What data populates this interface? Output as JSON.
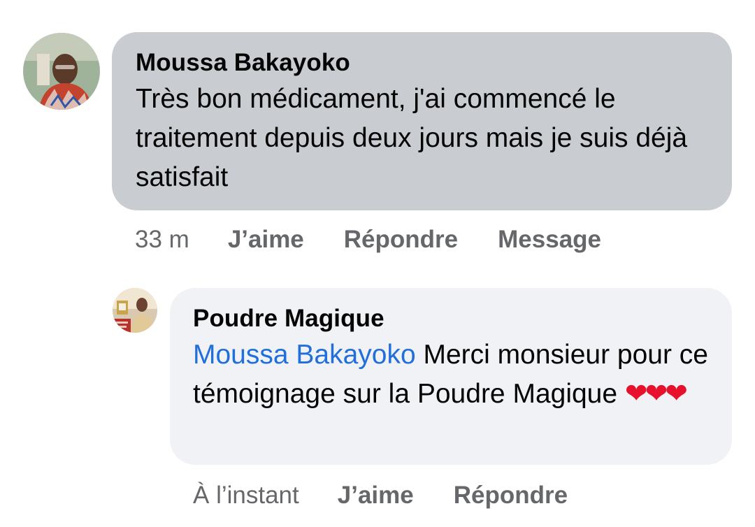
{
  "comment": {
    "author": "Moussa Bakayoko",
    "text": "Très bon médicament, j'ai commencé le traitement depuis deux jours mais je suis déjà satisfait",
    "time": "33 m",
    "actions": {
      "like": "J’aime",
      "reply": "Répondre",
      "message": "Message"
    }
  },
  "reply": {
    "author": "Poudre Magique",
    "mention": "Moussa Bakayoko",
    "text": " Merci monsieur pour ce témoignage sur la Poudre Magique ",
    "hearts": "❤❤❤",
    "time": "À l’instant",
    "actions": {
      "like": "J’aime",
      "reply": "Répondre"
    }
  },
  "colors": {
    "main_bubble": "#c9ccd1",
    "reply_bubble": "#f0f2f5",
    "mention": "#216fdb",
    "meta": "#65676b",
    "heart": "#e8112d"
  }
}
